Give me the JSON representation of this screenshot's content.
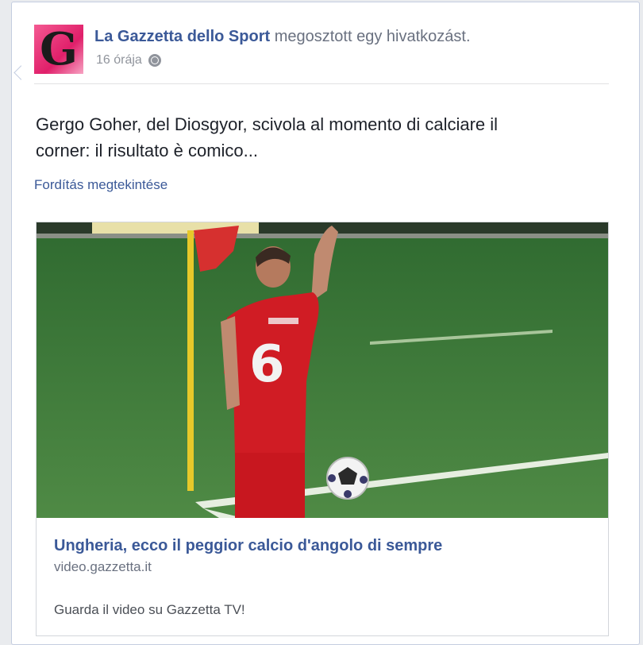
{
  "post": {
    "page_name": "La Gazzetta dello Sport",
    "action_text": "megosztott egy hivatkozást.",
    "avatar_letter": "G",
    "time": "16 órája",
    "privacy_icon": "globe-icon",
    "message_line1": "Gergo Goher, del Diosgyor, scivola al momento di calciare il",
    "message_line2": "corner: il risultato è comico...",
    "translate_label": "Fordítás megtekintése"
  },
  "link_preview": {
    "title": "Ungheria, ecco il peggior calcio d'angolo di sempre",
    "domain": "video.gazzetta.it",
    "description": "Guarda il video su Gazzetta TV!",
    "jersey_number": "6"
  },
  "colors": {
    "link_blue": "#3b5998",
    "pitch_green": "#3f7a3a",
    "jersey_red": "#d01c24",
    "avatar_pink": "#e01f6a"
  }
}
